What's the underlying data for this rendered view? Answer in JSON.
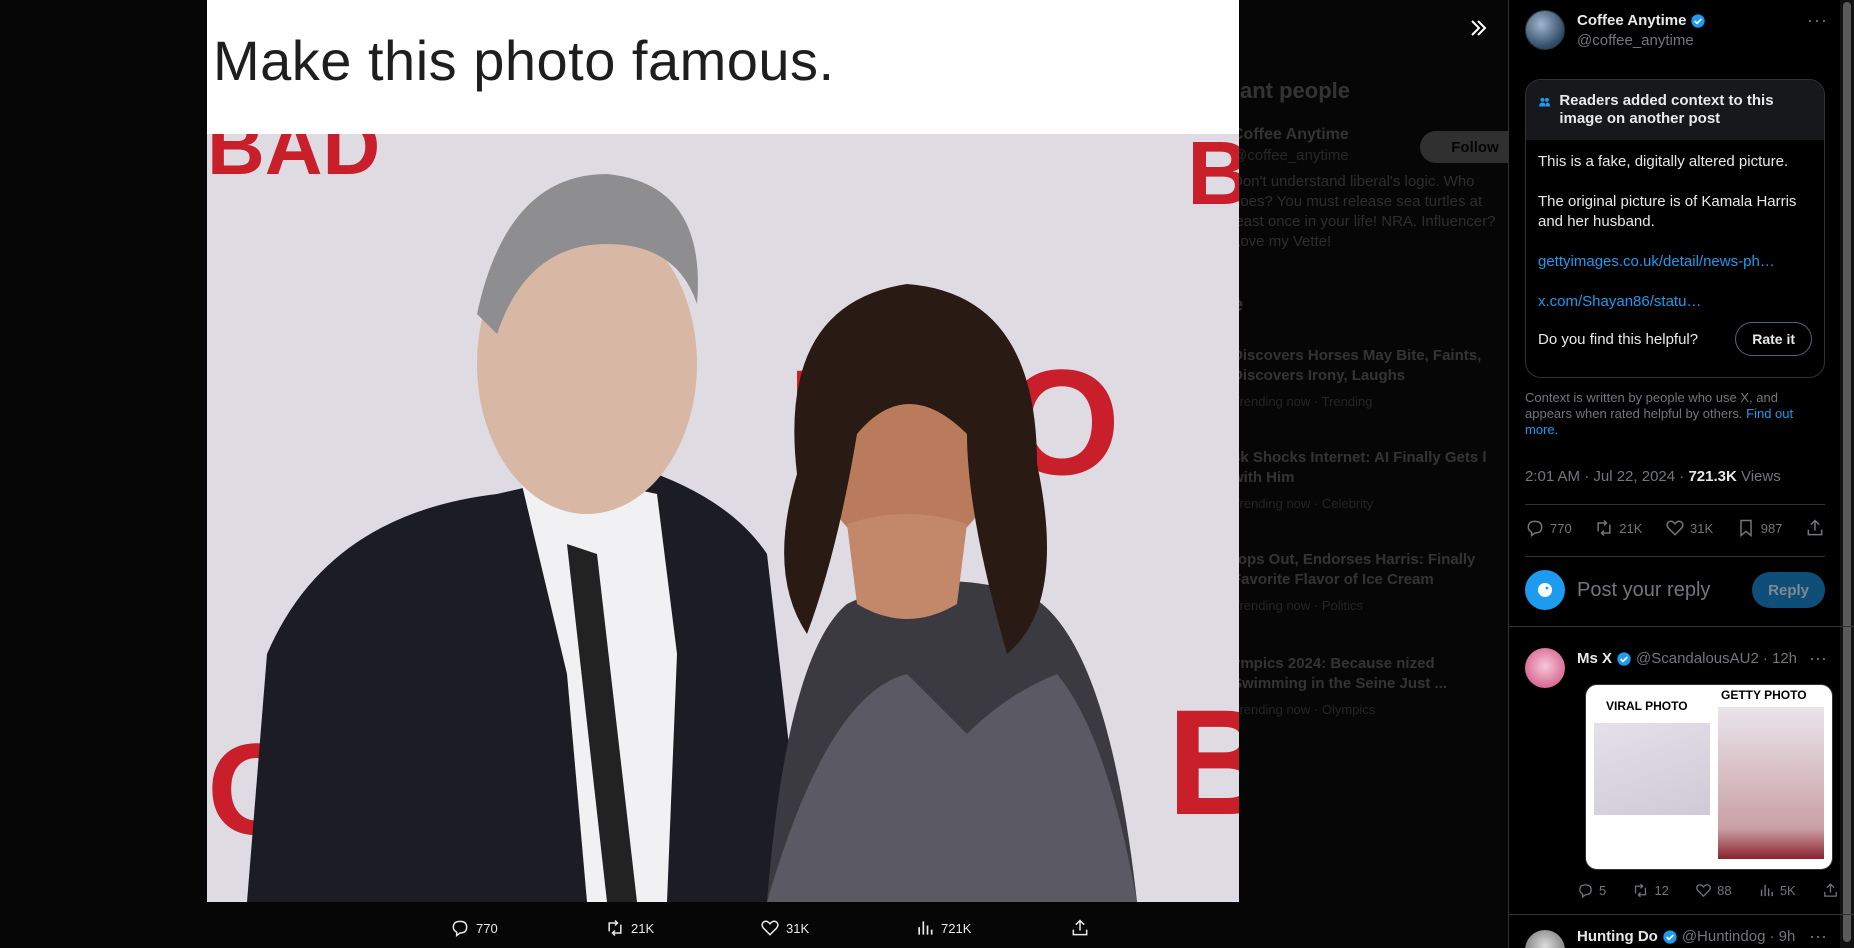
{
  "viewer": {
    "image_caption": "Make this photo famous.",
    "actions": [
      {
        "icon": "reply-icon",
        "count": "770"
      },
      {
        "icon": "repost-icon",
        "count": "21K"
      },
      {
        "icon": "like-icon",
        "count": "31K"
      },
      {
        "icon": "views-icon",
        "count": "721K"
      },
      {
        "icon": "share-icon",
        "count": ""
      }
    ],
    "collapse_icon": "double-chevron-right-icon",
    "background_sidebar": {
      "title": "ant people",
      "user_name": "Coffee Anytime",
      "user_handle": "@coffee_anytime",
      "follow_label": "Follow",
      "bio": "Don't understand liberal's logic. Who does? You must release sea turtles at least once in your life! NRA. Influencer? Love my Vette!",
      "section": "e",
      "items": [
        {
          "title": "Discovers Horses May Bite, Faints, Discovers Irony, Laughs",
          "meta": "Trending now · Trending"
        },
        {
          "title": "sk Shocks Internet: AI Finally Gets l with Him",
          "meta": "Trending now · Celebrity"
        },
        {
          "title": "rops Out, Endorses Harris: Finally Favorite Flavor of Ice Cream",
          "meta": "Trending now · Politics"
        },
        {
          "title": "ympics 2024: Because nized Swimming in the Seine Just ...",
          "meta": "Trending now · Olympics"
        }
      ]
    }
  },
  "post": {
    "author_name": "Coffee Anytime",
    "author_handle": "@coffee_anytime",
    "more_label": "···",
    "community_note": {
      "header": "Readers added context to this image on another post",
      "body_1": "This is a fake, digitally altered picture.",
      "body_2": "The original picture is of Kamala Harris and her husband.",
      "link_1": "gettyimages.co.uk/detail/news-ph…",
      "link_2": "x.com/Shayan86/statu…",
      "question": "Do you find this helpful?",
      "rate_label": "Rate it"
    },
    "note_footer": "Context is written by people who use X, and appears when rated helpful by others.",
    "note_footer_link": "Find out more.",
    "time": "2:01 AM · Jul 22, 2024 · ",
    "views_count": "721.3K",
    "views_label": " Views",
    "stats": {
      "replies": "770",
      "reposts": "21K",
      "likes": "31K",
      "bookmarks": "987"
    },
    "reply_placeholder": "Post your reply",
    "reply_button": "Reply"
  },
  "replies": [
    {
      "name": "Ms X",
      "handle": "@ScandalousAU2",
      "time": "· 12h",
      "media_label_1": "VIRAL PHOTO",
      "media_label_2": "GETTY PHOTO",
      "stats": {
        "replies": "5",
        "reposts": "12",
        "likes": "88",
        "views": "5K"
      }
    },
    {
      "name": "Hunting Do",
      "handle": "@Huntindog",
      "time": "· 9h"
    }
  ],
  "colors": {
    "accent": "#1d9bf0",
    "background": "#000000",
    "muted_text": "#71767b",
    "red_backdrop": "#c91f2a"
  }
}
